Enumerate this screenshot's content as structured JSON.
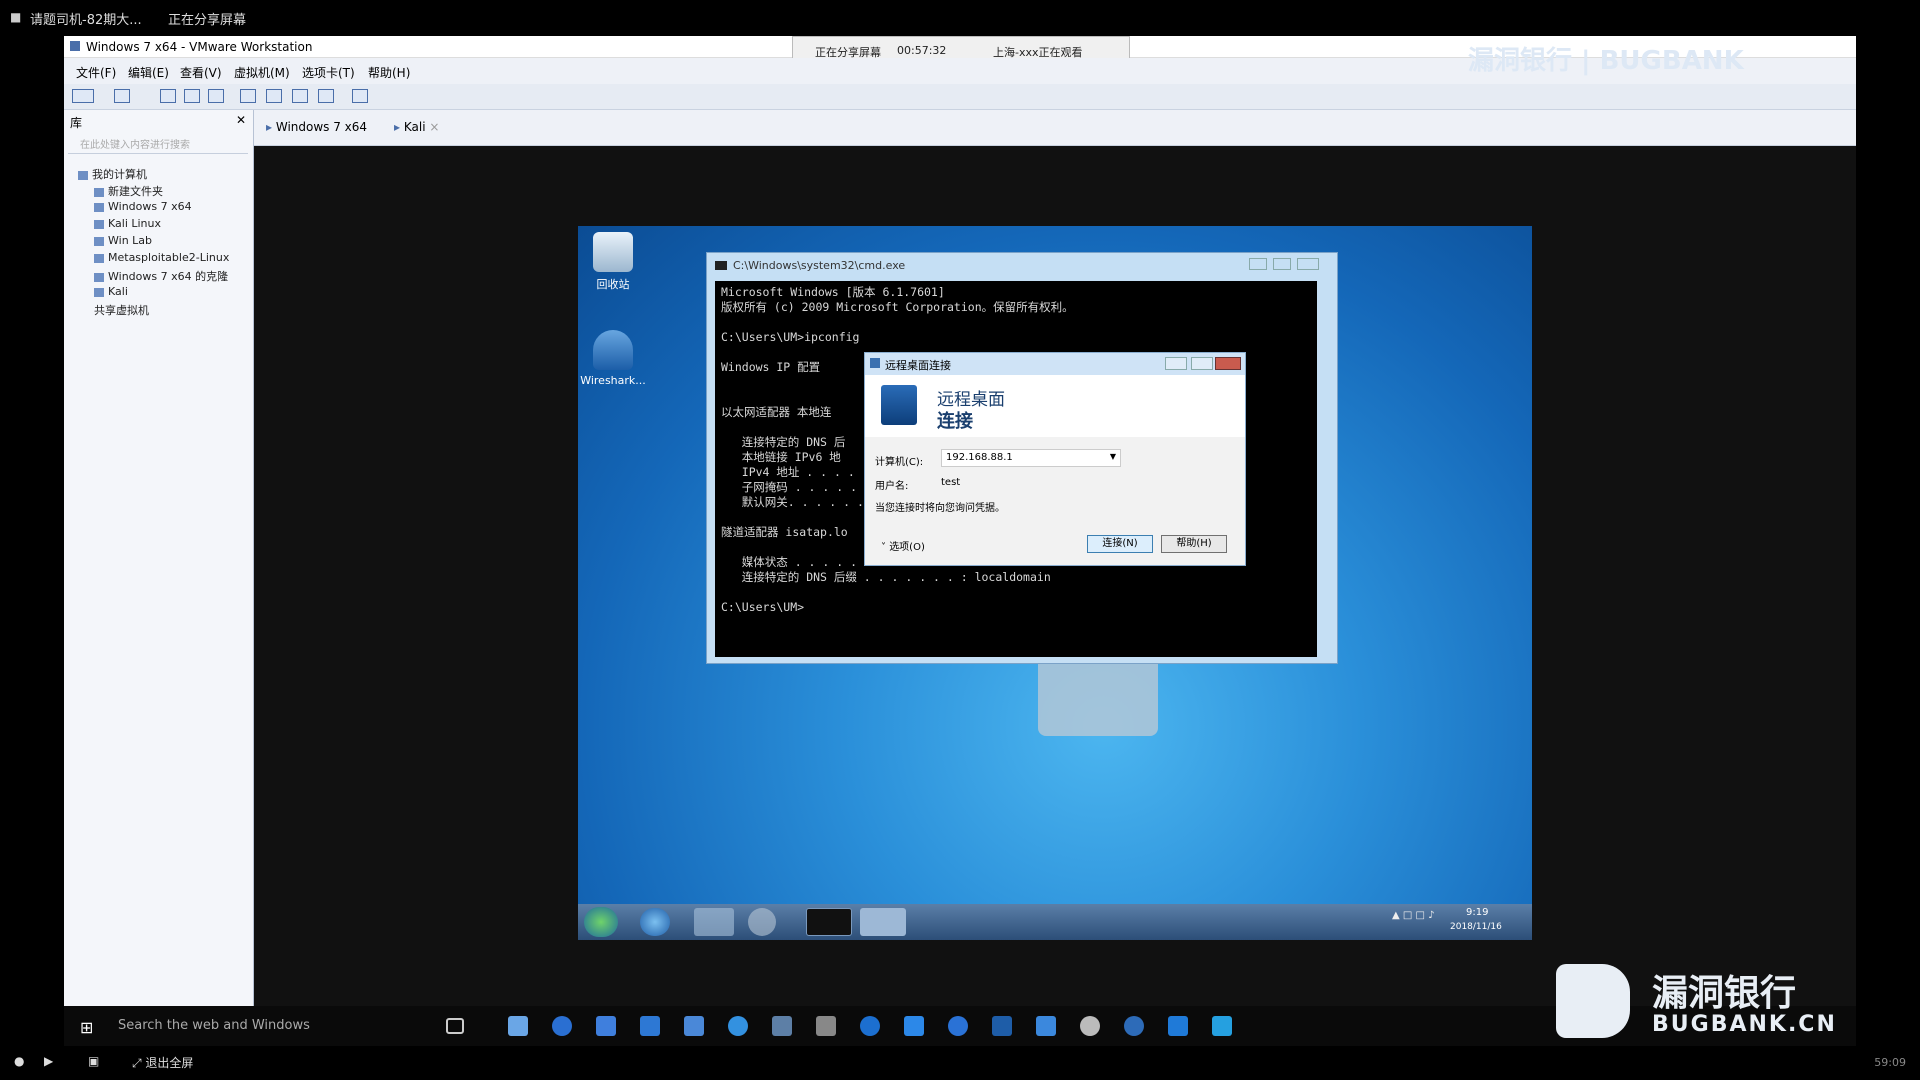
{
  "topbar": {
    "meeting_title": "请题司机-82期大...",
    "share_status": "正在分享屏幕"
  },
  "sharebar": {
    "status": "正在分享屏幕",
    "timer": "00:57:32",
    "viewers": "上海-xxx正在观看"
  },
  "vmware": {
    "title": "Windows 7 x64 - VMware Workstation",
    "menu": [
      "文件(F)",
      "编辑(E)",
      "查看(V)",
      "虚拟机(M)",
      "选项卡(T)",
      "帮助(H)"
    ],
    "library_header": "库",
    "library_search_placeholder": "在此处键入内容进行搜索",
    "tree": {
      "root": "我的计算机",
      "items": [
        "新建文件夹",
        "Windows 7 x64",
        "Kali Linux",
        "Win Lab",
        "Metasploitable2-Linux",
        "Windows 7 x64 的克隆",
        "Kali"
      ],
      "shared": "共享虚拟机"
    },
    "tabs": [
      "Windows 7 x64",
      "Kali"
    ]
  },
  "guest": {
    "desktop_icons": [
      "回收站",
      "Wireshark..."
    ],
    "cmd": {
      "title": "C:\\Windows\\system32\\cmd.exe",
      "lines": [
        "Microsoft Windows [版本 6.1.7601]",
        "版权所有 (c) 2009 Microsoft Corporation。保留所有权利。",
        "",
        "C:\\Users\\UM>ipconfig",
        "",
        "Windows IP 配置",
        "",
        "",
        "以太网适配器 本地连",
        "",
        "   连接特定的 DNS 后",
        "   本地链接 IPv6 地",
        "   IPv4 地址 . . . .",
        "   子网掩码 . . . . .",
        "   默认网关. . . . . .",
        "",
        "隧道适配器 isatap.lo",
        "",
        "   媒体状态 . . . . .",
        "   连接特定的 DNS 后缀 . . . . . . . : localdomain",
        "",
        "C:\\Users\\UM>"
      ]
    },
    "rdp": {
      "title": "远程桌面连接",
      "heading_line1": "远程桌面",
      "heading_line2": "连接",
      "computer_label": "计算机(C):",
      "computer_value": "192.168.88.1",
      "username_label": "用户名:",
      "username_value": "test",
      "hint": "当您连接时将向您询问凭据。",
      "options_label": "选项(O)",
      "connect_label": "连接(N)",
      "help_label": "帮助(H)"
    },
    "clock": {
      "time": "9:19",
      "date": "2018/11/16"
    }
  },
  "host_taskbar": {
    "search_placeholder": "Search the web and Windows"
  },
  "bottombar": {
    "exit_fullscreen": "退出全屏",
    "clock": "59:09"
  },
  "watermark": {
    "top_right": "漏洞银行 | BUGBANK",
    "brand_cn": "漏洞银行",
    "brand_en": "BUGBANK.CN"
  },
  "colors": {
    "desktop_blue": "#2a8fd9",
    "accent": "#4a6ea9"
  }
}
